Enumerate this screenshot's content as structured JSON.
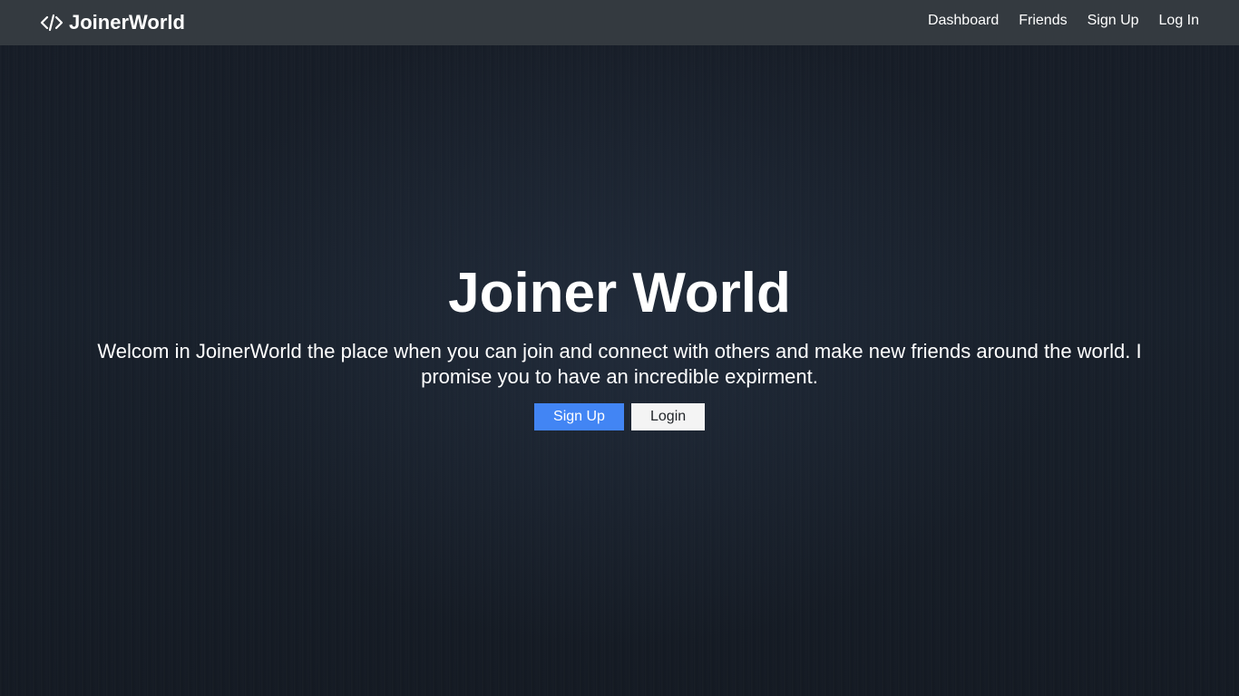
{
  "navbar": {
    "brand": {
      "icon": "code-icon",
      "label": "JoinerWorld"
    },
    "links": [
      {
        "label": "Dashboard"
      },
      {
        "label": "Friends"
      },
      {
        "label": "Sign Up"
      },
      {
        "label": "Log In"
      }
    ]
  },
  "hero": {
    "title": "Joiner World",
    "text": "Welcom in JoinerWorld the place when you can join and connect with others and make new friends around the world. I promise you to have an incredible expirment.",
    "buttons": {
      "signup": "Sign Up",
      "login": "Login"
    }
  },
  "colors": {
    "navbar_bg": "#343a40",
    "page_bg": "#151b25",
    "primary": "#4285f4",
    "light": "#f4f4f4"
  }
}
